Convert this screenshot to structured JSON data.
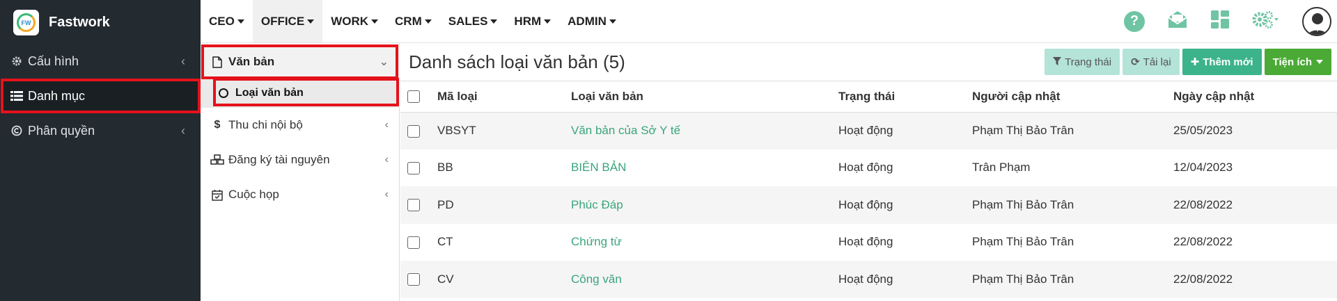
{
  "brand": {
    "name": "Fastwork",
    "logo_text": "FW"
  },
  "sidebar": {
    "items": [
      {
        "label": "Cấu hình",
        "icon": "gear-icon"
      },
      {
        "label": "Danh mục",
        "icon": "list-icon"
      },
      {
        "label": "Phân quyền",
        "icon": "copyright-icon"
      }
    ]
  },
  "topnav": {
    "menu": [
      "CEO",
      "OFFICE",
      "WORK",
      "CRM",
      "SALES",
      "HRM",
      "ADMIN"
    ],
    "selected": "OFFICE"
  },
  "subnav": {
    "head": "Văn bản",
    "child": "Loại văn bản",
    "items": [
      {
        "label": "Thu chi nội bộ",
        "icon": "dollar-icon"
      },
      {
        "label": "Đăng ký tài nguyên",
        "icon": "cubes-icon"
      },
      {
        "label": "Cuộc họp",
        "icon": "calendar-check-icon"
      }
    ]
  },
  "page": {
    "title": "Danh sách loại văn bản (5)",
    "buttons": {
      "status": "Trạng thái",
      "reload": "Tải lại",
      "add": "Thêm mới",
      "utilities": "Tiện ích"
    }
  },
  "table": {
    "headers": [
      "Mã loại",
      "Loại văn bản",
      "Trạng thái",
      "Người cập nhật",
      "Ngày cập nhật"
    ],
    "rows": [
      [
        "VBSYT",
        "Văn bản của Sở Y tế",
        "Hoạt động",
        "Phạm Thị Bảo Trân",
        "25/05/2023"
      ],
      [
        "BB",
        "BIÊN BẢN",
        "Hoạt động",
        "Trân Phạm",
        "12/04/2023"
      ],
      [
        "PD",
        "Phúc Đáp",
        "Hoạt động",
        "Phạm Thị Bảo Trân",
        "22/08/2022"
      ],
      [
        "CT",
        "Chứng từ",
        "Hoạt động",
        "Phạm Thị Bảo Trân",
        "22/08/2022"
      ],
      [
        "CV",
        "Công văn",
        "Hoạt động",
        "Phạm Thị Bảo Trân",
        "22/08/2022"
      ]
    ]
  },
  "colors": {
    "sidebar_bg": "#232a30",
    "accent_green": "#3cb38a",
    "highlight_red": "#e5121b"
  }
}
